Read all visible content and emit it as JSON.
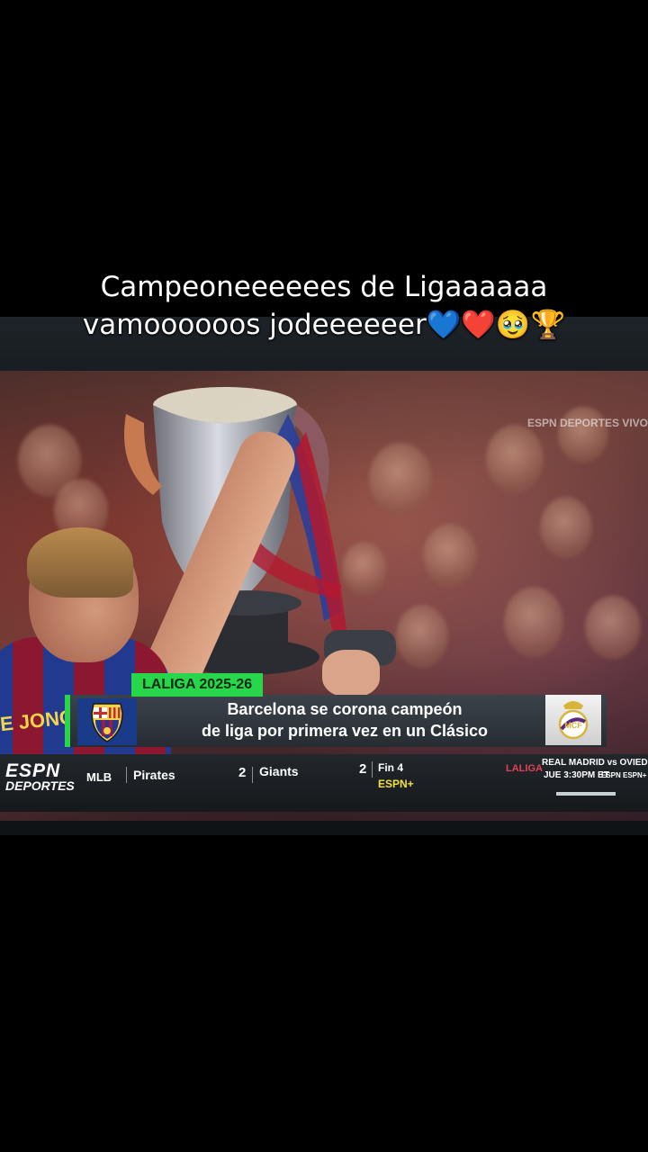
{
  "caption": {
    "line1": "Campeoneeeeees de Ligaaaaaa",
    "line2": "vamoooooos jodeeeeeer💙❤️🥹🏆"
  },
  "broadcast": {
    "channel_bug": "ESPN DEPORTES VIVO",
    "jersey_name": "E JONG",
    "lower_third": {
      "tag": "LALIGA 2025-26",
      "headline_line1": "Barcelona se corona campeón",
      "headline_line2": "de liga por primera vez en un Clásico",
      "crest_left": "FCB",
      "crest_right": "RM"
    },
    "ticker": {
      "logo_line1": "ESPN",
      "logo_line2": "DEPORTES",
      "league": "MLB",
      "team1": "Pirates",
      "score1": "2",
      "team2": "Giants",
      "score2": "2",
      "status": "Fin 4",
      "network": "ESPN+",
      "promo_league": "LALIGA",
      "promo_match": "REAL MADRID vs OVIEDO",
      "promo_time": "JUE 3:30PM ET",
      "promo_networks": "ESPN ESPN+"
    }
  },
  "colors": {
    "accent_green": "#27d64a",
    "ticker_bg": "#1c2125",
    "espnplus_yellow": "#f3e043",
    "laliga_red": "#e64057"
  }
}
